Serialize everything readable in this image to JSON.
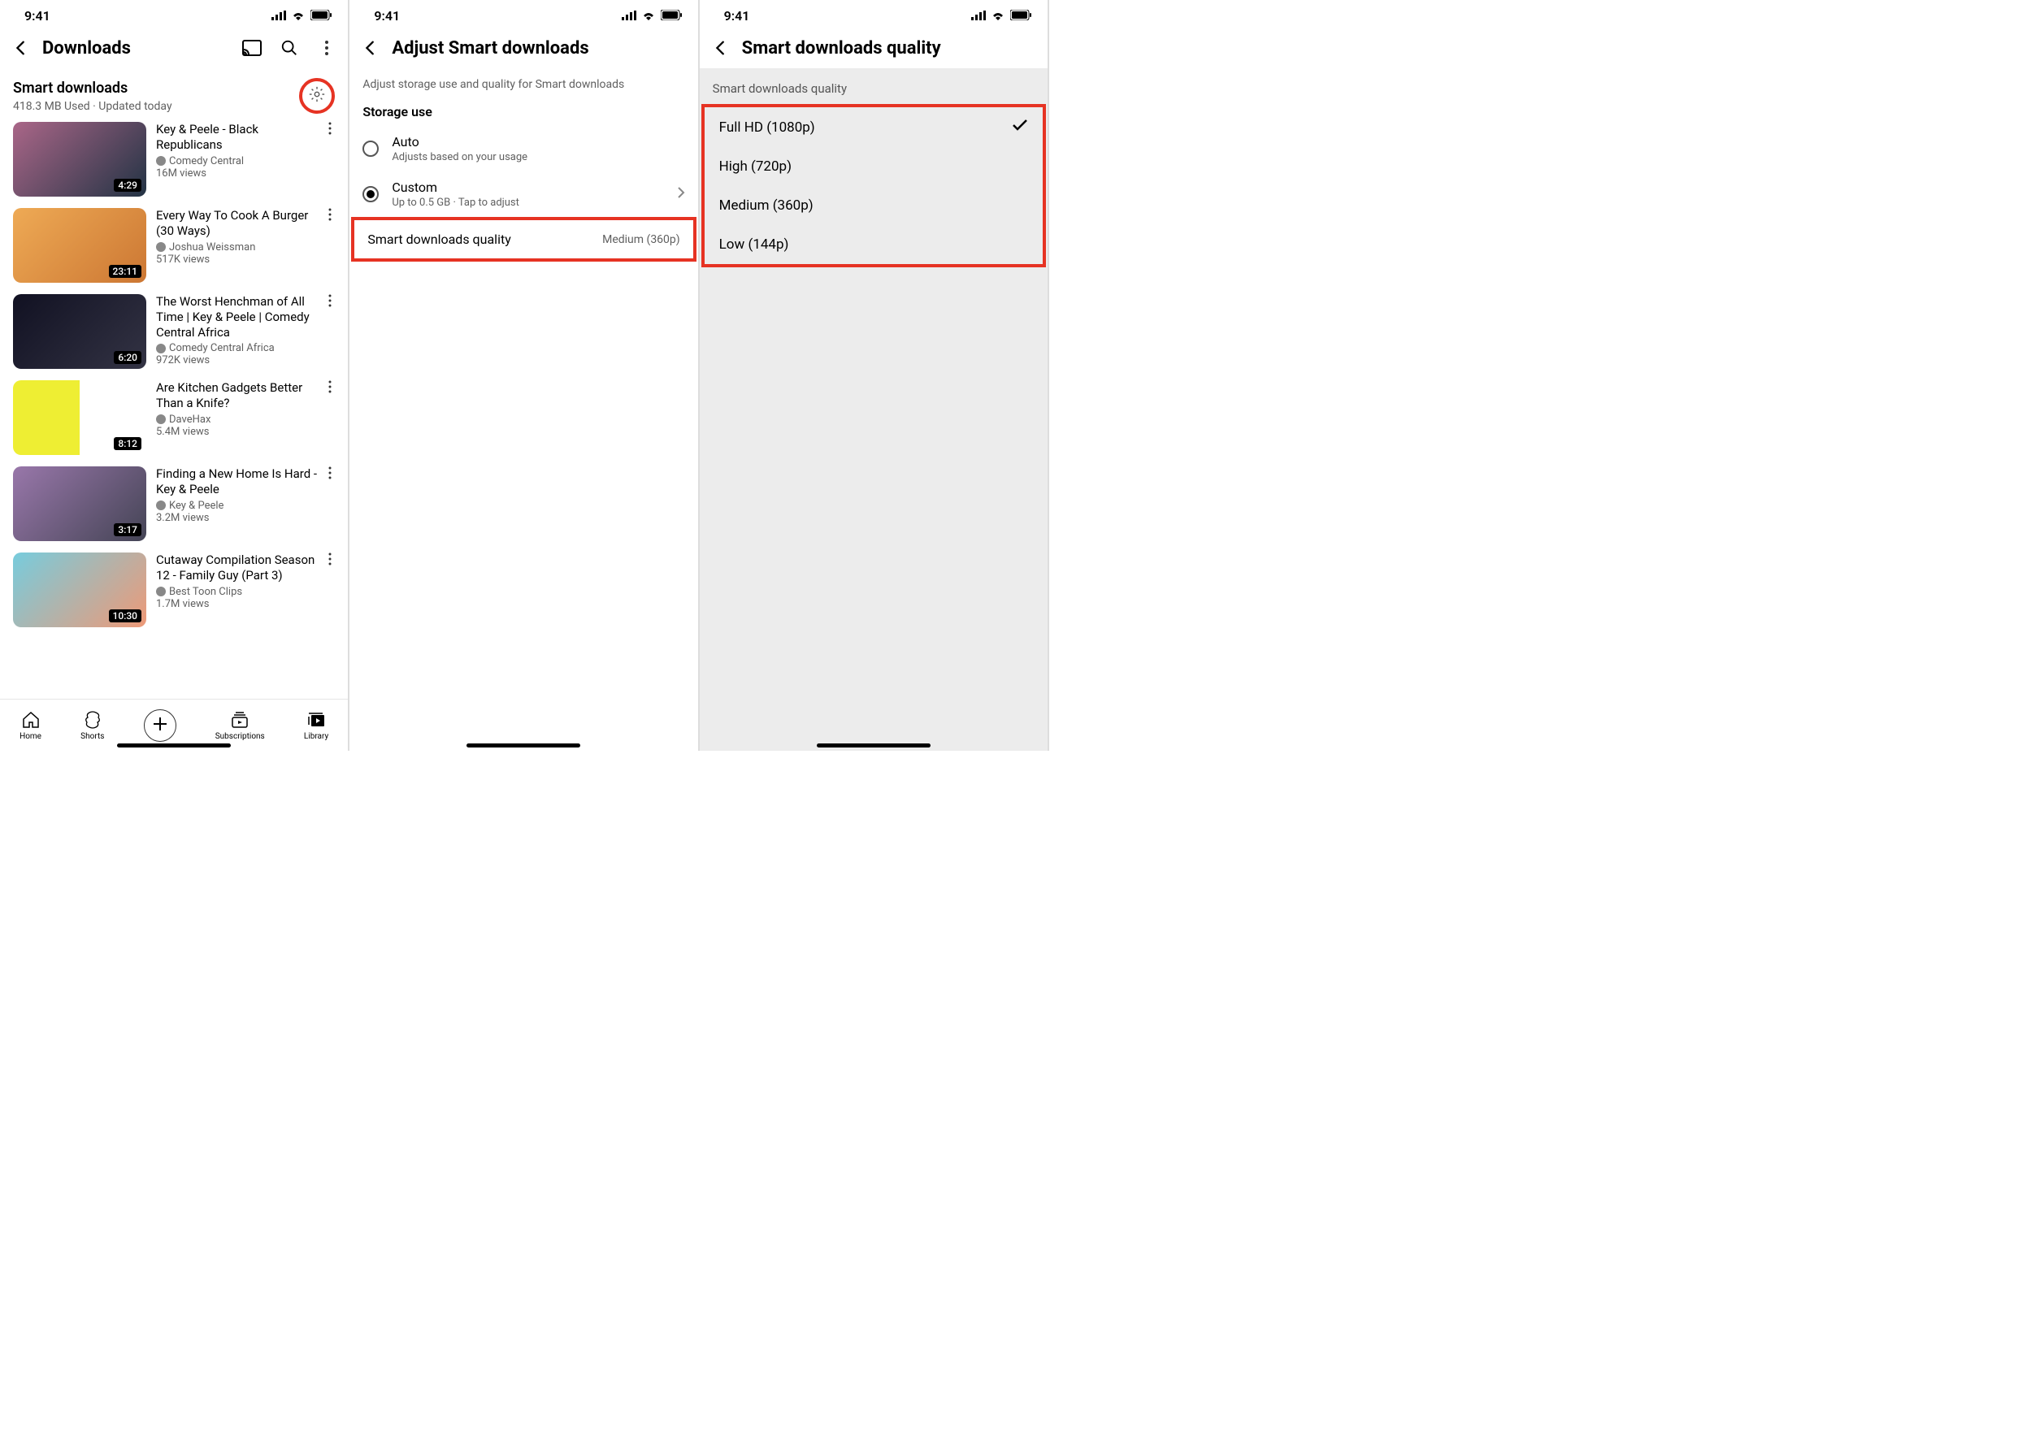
{
  "status": {
    "time": "9:41"
  },
  "screen1": {
    "title": "Downloads",
    "section_title": "Smart downloads",
    "section_sub": "418.3 MB Used · Updated today",
    "videos": [
      {
        "title": "Key & Peele - Black Republicans",
        "channel": "Comedy Central",
        "views": "16M views",
        "duration": "4:29"
      },
      {
        "title": "Every Way To Cook A Burger (30 Ways)",
        "channel": "Joshua Weissman",
        "views": "517K views",
        "duration": "23:11"
      },
      {
        "title": "The Worst Henchman of All Time | Key & Peele | Comedy Central Africa",
        "channel": "Comedy Central Africa",
        "views": "972K views",
        "duration": "6:20"
      },
      {
        "title": "Are Kitchen Gadgets Better Than a Knife?",
        "channel": "DaveHax",
        "views": "5.4M views",
        "duration": "8:12"
      },
      {
        "title": "Finding a New Home Is Hard - Key & Peele",
        "channel": "Key & Peele",
        "views": "3.2M views",
        "duration": "3:17"
      },
      {
        "title": "Cutaway Compilation Season 12 - Family Guy (Part 3)",
        "channel": "Best Toon Clips",
        "views": "1.7M views",
        "duration": "10:30"
      }
    ],
    "nav": {
      "home": "Home",
      "shorts": "Shorts",
      "subs": "Subscriptions",
      "library": "Library"
    }
  },
  "screen2": {
    "title": "Adjust Smart downloads",
    "subtitle": "Adjust storage use and quality for Smart downloads",
    "storage_label": "Storage use",
    "auto": {
      "title": "Auto",
      "sub": "Adjusts based on your usage"
    },
    "custom": {
      "title": "Custom",
      "sub": "Up to 0.5 GB · Tap to adjust"
    },
    "quality_label": "Smart downloads quality",
    "quality_value": "Medium (360p)"
  },
  "screen3": {
    "title": "Smart downloads quality",
    "label": "Smart downloads quality",
    "options": [
      {
        "label": "Full HD (1080p)",
        "selected": true
      },
      {
        "label": "High (720p)",
        "selected": false
      },
      {
        "label": "Medium (360p)",
        "selected": false
      },
      {
        "label": "Low (144p)",
        "selected": false
      }
    ]
  }
}
